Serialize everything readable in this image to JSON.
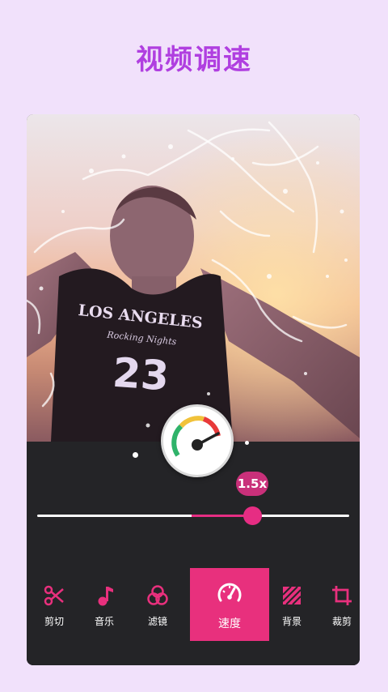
{
  "header": {
    "title": "视频调速"
  },
  "photo": {
    "shirt_text": "LOS ANGELES",
    "shirt_script": "Rocking Nights",
    "shirt_number": "23"
  },
  "speed": {
    "label": "1.5x",
    "value": 1.5
  },
  "toolbar": {
    "items": [
      {
        "label": "剪切",
        "icon": "scissors-icon"
      },
      {
        "label": "音乐",
        "icon": "music-note-icon"
      },
      {
        "label": "滤镜",
        "icon": "filter-circles-icon"
      },
      {
        "label": "速度",
        "icon": "speedometer-icon",
        "active": true
      },
      {
        "label": "背景",
        "icon": "background-pattern-icon"
      },
      {
        "label": "裁剪",
        "icon": "crop-icon"
      }
    ]
  },
  "colors": {
    "accent": "#e8307d",
    "title": "#b03fe0",
    "panel": "#242427",
    "page_bg": "#f1e1fb"
  }
}
